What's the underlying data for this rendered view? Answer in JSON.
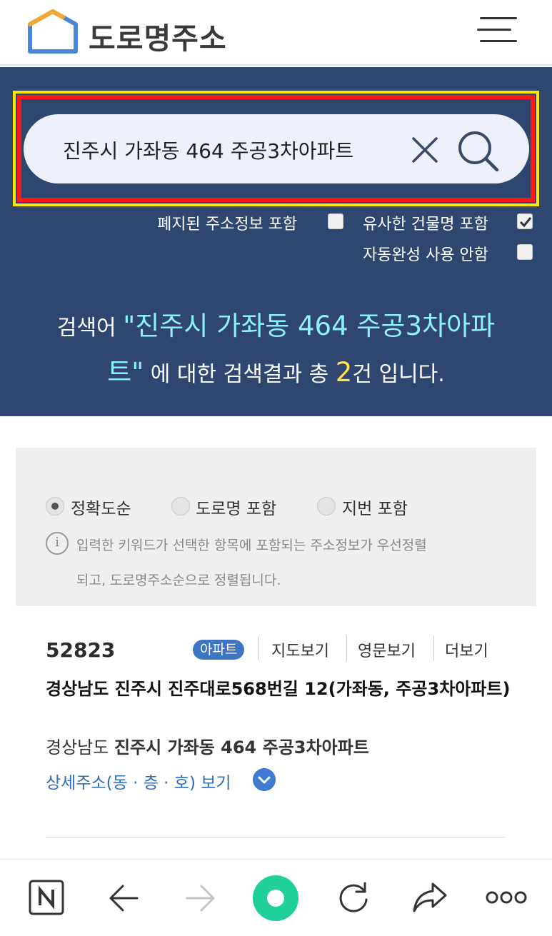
{
  "header": {
    "brand": "도로명주소",
    "logo_icon": "house-logo-icon",
    "menu_icon": "hamburger-menu-icon"
  },
  "search": {
    "query": "진주시 가좌동 464 주공3차아파트",
    "clear_icon": "close-icon",
    "search_icon": "search-icon",
    "options": {
      "include_abolished": {
        "label": "폐지된 주소정보 포함",
        "checked": false
      },
      "similar_building": {
        "label": "유사한 건물명 포함",
        "checked": true
      },
      "no_autocomplete": {
        "label": "자동완성 사용 안함",
        "checked": false
      }
    }
  },
  "result_summary": {
    "prefix": "검색어",
    "query_line1": "\"진주시 가좌동 464 주공3차아파",
    "query_line2": "트\"",
    "middle": "에 대한 검색결과 총",
    "count": "2",
    "suffix": "건 입니다."
  },
  "sort": {
    "options": [
      {
        "label": "정확도순",
        "selected": true
      },
      {
        "label": "도로명 포함",
        "selected": false
      },
      {
        "label": "지번 포함",
        "selected": false
      }
    ],
    "info_line1": "입력한 키워드가 선택한 항목에 포함되는 주소정보가 우선정렬",
    "info_line2": "되고, 도로명주소순으로 정렬됩니다."
  },
  "results": [
    {
      "zip": "52823",
      "badge": "아파트",
      "links": [
        "지도보기",
        "영문보기",
        "더보기"
      ],
      "road_address": "경상남도 진주시 진주대로568번길 12(가좌동, 주공3차아파트)",
      "jibun_prefix": "경상남도",
      "jibun_rest": "진주시 가좌동 464 주공3차아파트",
      "detail_label": "상세주소(동 · 층 · 호) 보기"
    }
  ],
  "colors": {
    "panel_bg": "#2f4670",
    "query_highlight": "#8ef0ff",
    "count_highlight": "#ffe14a",
    "link_blue": "#2f6dbd",
    "badge_blue": "#3d75c2"
  },
  "bottom_nav": {
    "icons": [
      "naver-n-icon",
      "back-arrow-icon",
      "forward-arrow-icon",
      "home-green-circle-icon",
      "refresh-icon",
      "share-icon",
      "more-dots-icon"
    ]
  }
}
